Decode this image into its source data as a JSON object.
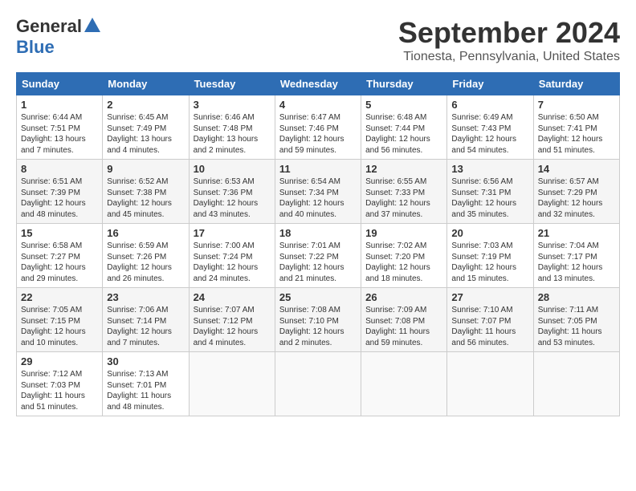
{
  "header": {
    "logo_general": "General",
    "logo_blue": "Blue",
    "month": "September 2024",
    "location": "Tionesta, Pennsylvania, United States"
  },
  "weekdays": [
    "Sunday",
    "Monday",
    "Tuesday",
    "Wednesday",
    "Thursday",
    "Friday",
    "Saturday"
  ],
  "weeks": [
    [
      {
        "day": "1",
        "sunrise": "6:44 AM",
        "sunset": "7:51 PM",
        "daylight": "13 hours and 7 minutes."
      },
      {
        "day": "2",
        "sunrise": "6:45 AM",
        "sunset": "7:49 PM",
        "daylight": "13 hours and 4 minutes."
      },
      {
        "day": "3",
        "sunrise": "6:46 AM",
        "sunset": "7:48 PM",
        "daylight": "13 hours and 2 minutes."
      },
      {
        "day": "4",
        "sunrise": "6:47 AM",
        "sunset": "7:46 PM",
        "daylight": "12 hours and 59 minutes."
      },
      {
        "day": "5",
        "sunrise": "6:48 AM",
        "sunset": "7:44 PM",
        "daylight": "12 hours and 56 minutes."
      },
      {
        "day": "6",
        "sunrise": "6:49 AM",
        "sunset": "7:43 PM",
        "daylight": "12 hours and 54 minutes."
      },
      {
        "day": "7",
        "sunrise": "6:50 AM",
        "sunset": "7:41 PM",
        "daylight": "12 hours and 51 minutes."
      }
    ],
    [
      {
        "day": "8",
        "sunrise": "6:51 AM",
        "sunset": "7:39 PM",
        "daylight": "12 hours and 48 minutes."
      },
      {
        "day": "9",
        "sunrise": "6:52 AM",
        "sunset": "7:38 PM",
        "daylight": "12 hours and 45 minutes."
      },
      {
        "day": "10",
        "sunrise": "6:53 AM",
        "sunset": "7:36 PM",
        "daylight": "12 hours and 43 minutes."
      },
      {
        "day": "11",
        "sunrise": "6:54 AM",
        "sunset": "7:34 PM",
        "daylight": "12 hours and 40 minutes."
      },
      {
        "day": "12",
        "sunrise": "6:55 AM",
        "sunset": "7:33 PM",
        "daylight": "12 hours and 37 minutes."
      },
      {
        "day": "13",
        "sunrise": "6:56 AM",
        "sunset": "7:31 PM",
        "daylight": "12 hours and 35 minutes."
      },
      {
        "day": "14",
        "sunrise": "6:57 AM",
        "sunset": "7:29 PM",
        "daylight": "12 hours and 32 minutes."
      }
    ],
    [
      {
        "day": "15",
        "sunrise": "6:58 AM",
        "sunset": "7:27 PM",
        "daylight": "12 hours and 29 minutes."
      },
      {
        "day": "16",
        "sunrise": "6:59 AM",
        "sunset": "7:26 PM",
        "daylight": "12 hours and 26 minutes."
      },
      {
        "day": "17",
        "sunrise": "7:00 AM",
        "sunset": "7:24 PM",
        "daylight": "12 hours and 24 minutes."
      },
      {
        "day": "18",
        "sunrise": "7:01 AM",
        "sunset": "7:22 PM",
        "daylight": "12 hours and 21 minutes."
      },
      {
        "day": "19",
        "sunrise": "7:02 AM",
        "sunset": "7:20 PM",
        "daylight": "12 hours and 18 minutes."
      },
      {
        "day": "20",
        "sunrise": "7:03 AM",
        "sunset": "7:19 PM",
        "daylight": "12 hours and 15 minutes."
      },
      {
        "day": "21",
        "sunrise": "7:04 AM",
        "sunset": "7:17 PM",
        "daylight": "12 hours and 13 minutes."
      }
    ],
    [
      {
        "day": "22",
        "sunrise": "7:05 AM",
        "sunset": "7:15 PM",
        "daylight": "12 hours and 10 minutes."
      },
      {
        "day": "23",
        "sunrise": "7:06 AM",
        "sunset": "7:14 PM",
        "daylight": "12 hours and 7 minutes."
      },
      {
        "day": "24",
        "sunrise": "7:07 AM",
        "sunset": "7:12 PM",
        "daylight": "12 hours and 4 minutes."
      },
      {
        "day": "25",
        "sunrise": "7:08 AM",
        "sunset": "7:10 PM",
        "daylight": "12 hours and 2 minutes."
      },
      {
        "day": "26",
        "sunrise": "7:09 AM",
        "sunset": "7:08 PM",
        "daylight": "11 hours and 59 minutes."
      },
      {
        "day": "27",
        "sunrise": "7:10 AM",
        "sunset": "7:07 PM",
        "daylight": "11 hours and 56 minutes."
      },
      {
        "day": "28",
        "sunrise": "7:11 AM",
        "sunset": "7:05 PM",
        "daylight": "11 hours and 53 minutes."
      }
    ],
    [
      {
        "day": "29",
        "sunrise": "7:12 AM",
        "sunset": "7:03 PM",
        "daylight": "11 hours and 51 minutes."
      },
      {
        "day": "30",
        "sunrise": "7:13 AM",
        "sunset": "7:01 PM",
        "daylight": "11 hours and 48 minutes."
      },
      null,
      null,
      null,
      null,
      null
    ]
  ]
}
